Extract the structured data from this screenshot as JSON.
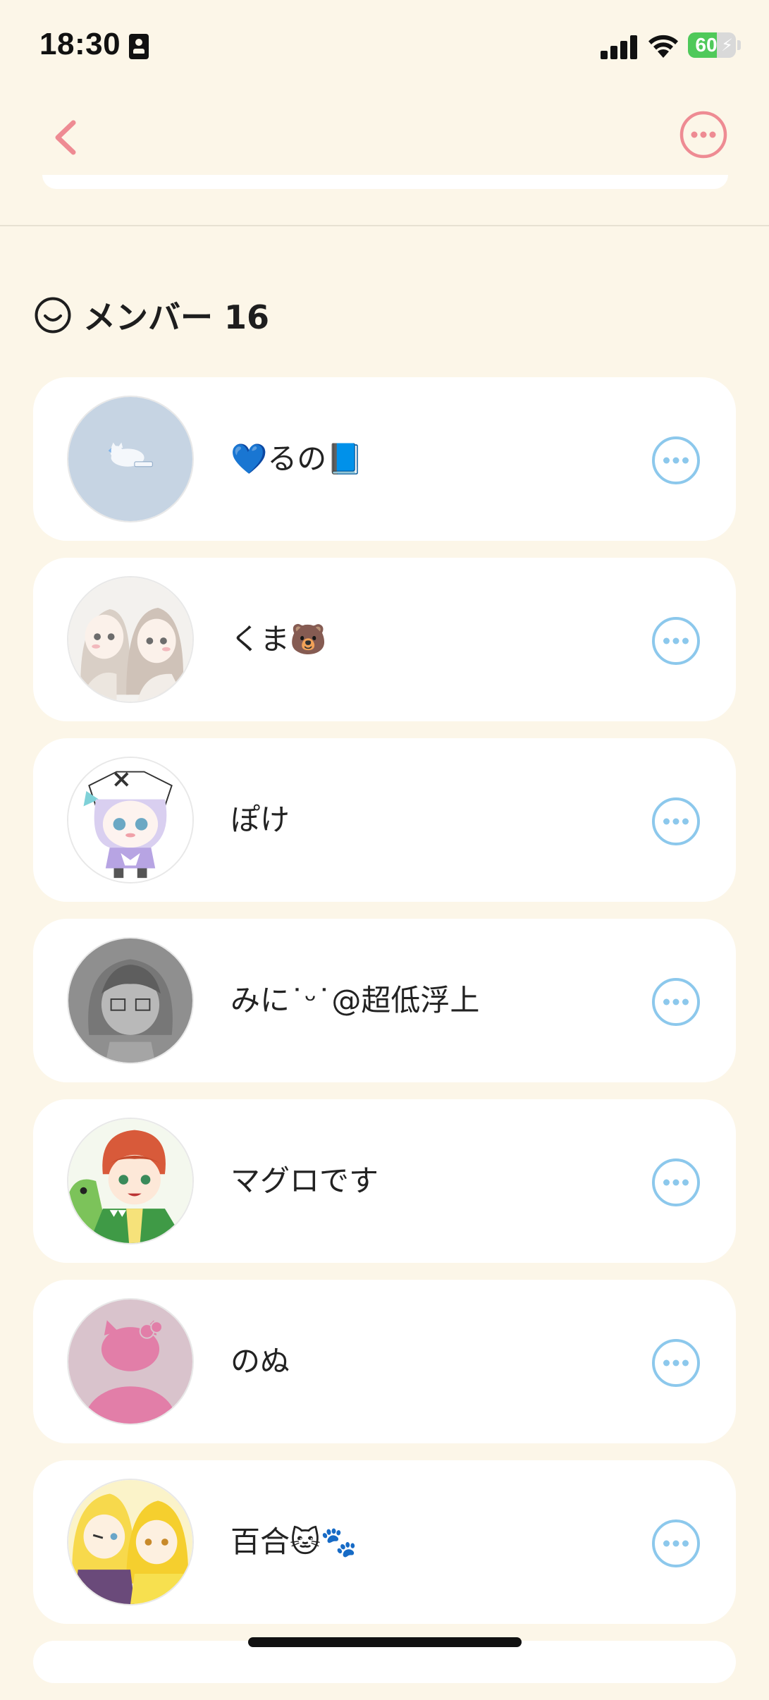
{
  "status_bar": {
    "time": "18:30",
    "battery_level": "60",
    "battery_percent": 60,
    "signal_bars": 4,
    "icons": [
      "id-card-icon",
      "cellular-signal-icon",
      "wifi-icon",
      "battery-charging-icon"
    ]
  },
  "nav": {
    "back_icon": "chevron-left-icon",
    "more_icon": "ellipsis-circle-icon",
    "accent_color": "#ee8b93"
  },
  "members_section": {
    "icon": "smile-face-icon",
    "title": "メンバー 16"
  },
  "members": [
    {
      "name": "💙るの📘",
      "avatar": "white-cat-on-blue-avatar"
    },
    {
      "name": "くま🐻",
      "avatar": "two-girls-sketch-avatar"
    },
    {
      "name": "ぽけ",
      "avatar": "purple-hair-chibi-avatar"
    },
    {
      "name": "みに˙ᵕ˙@超低浮上",
      "avatar": "grey-pencil-sketch-avatar"
    },
    {
      "name": "マグロです",
      "avatar": "red-hair-boy-dinosaur-avatar"
    },
    {
      "name": "のぬ",
      "avatar": "hello-kitty-silhouette-avatar"
    },
    {
      "name": "百合🐱🐾",
      "avatar": "yellow-hair-duo-avatar"
    }
  ],
  "row_action_icon": "ellipsis-circle-icon",
  "colors": {
    "background": "#fcf6e8",
    "card": "#ffffff",
    "row_action": "#8cc8ec",
    "battery_green": "#4fc95a"
  }
}
